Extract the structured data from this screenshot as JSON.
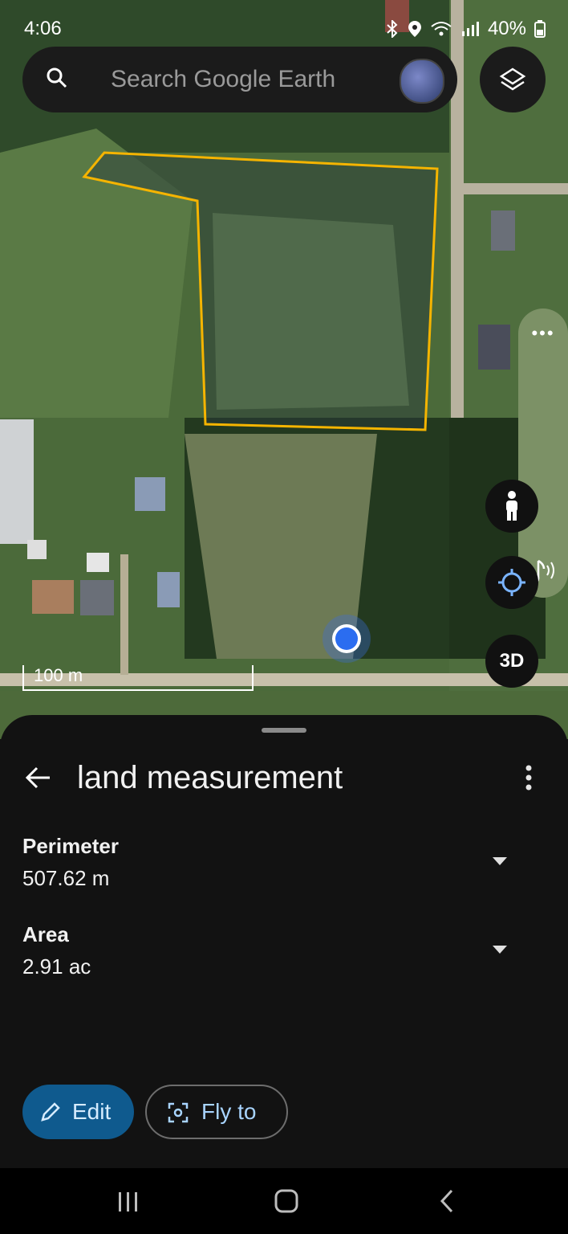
{
  "status_bar": {
    "time": "4:06",
    "battery": "40%"
  },
  "search": {
    "placeholder": "Search Google Earth"
  },
  "map": {
    "scale_label": "100 m",
    "btn_3d": "3D",
    "polygon_color": "#f5b400"
  },
  "sheet": {
    "title": "land measurement",
    "fields": [
      {
        "label": "Perimeter",
        "value": "507.62 m"
      },
      {
        "label": "Area",
        "value": "2.91 ac"
      }
    ],
    "edit_label": "Edit",
    "fly_label": "Fly to"
  },
  "colors": {
    "accent": "#0f5a8e",
    "sheet_bg": "#121212",
    "panel": "#7c9166"
  },
  "icons": [
    "search-icon",
    "layers-icon",
    "pegman-icon",
    "location-icon",
    "music-icon",
    "back-arrow-icon",
    "more-vert-icon",
    "pencil-icon",
    "focus-icon"
  ]
}
